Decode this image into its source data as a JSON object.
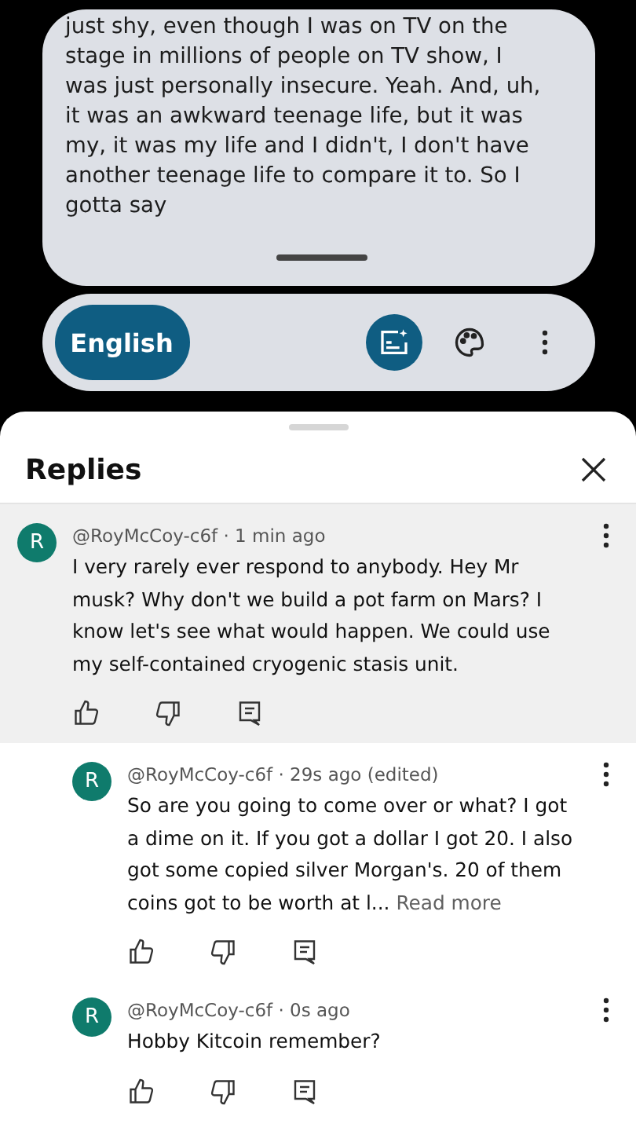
{
  "caption": {
    "lines": [
      "just shy, even though I was on TV on the",
      "stage in millions of people on TV show, I",
      "was just personally insecure. Yeah. And, uh,",
      "it was an awkward teenage life, but it was",
      "my, it was my life and I didn't, I don't have",
      "another teenage life to compare it to. So I",
      "gotta say"
    ]
  },
  "caption_bar": {
    "language": "English",
    "captions_on": true
  },
  "sheet": {
    "title": "Replies"
  },
  "comments": [
    {
      "avatar": "R",
      "meta": "@RoyMcCoy-c6f · 1 min ago",
      "text": "I very rarely ever respond to anybody. Hey Mr musk? Why don't we build a pot farm on Mars? I know let's see what would happen. We could use my self-contained cryogenic stasis unit.",
      "selected": true,
      "kind": "parent"
    },
    {
      "avatar": "R",
      "meta": "@RoyMcCoy-c6f · 29s ago (edited)",
      "text": "So are you going to come over or what? I got a dime on it. If you got a dollar I got 20. I also got some copied silver Morgan's. 20 of them coins got to be worth at l...",
      "read_more": "Read more",
      "selected": false,
      "kind": "reply"
    },
    {
      "avatar": "R",
      "meta": "@RoyMcCoy-c6f · 0s ago",
      "text": "Hobby Kitcoin remember?",
      "selected": false,
      "kind": "reply"
    }
  ]
}
